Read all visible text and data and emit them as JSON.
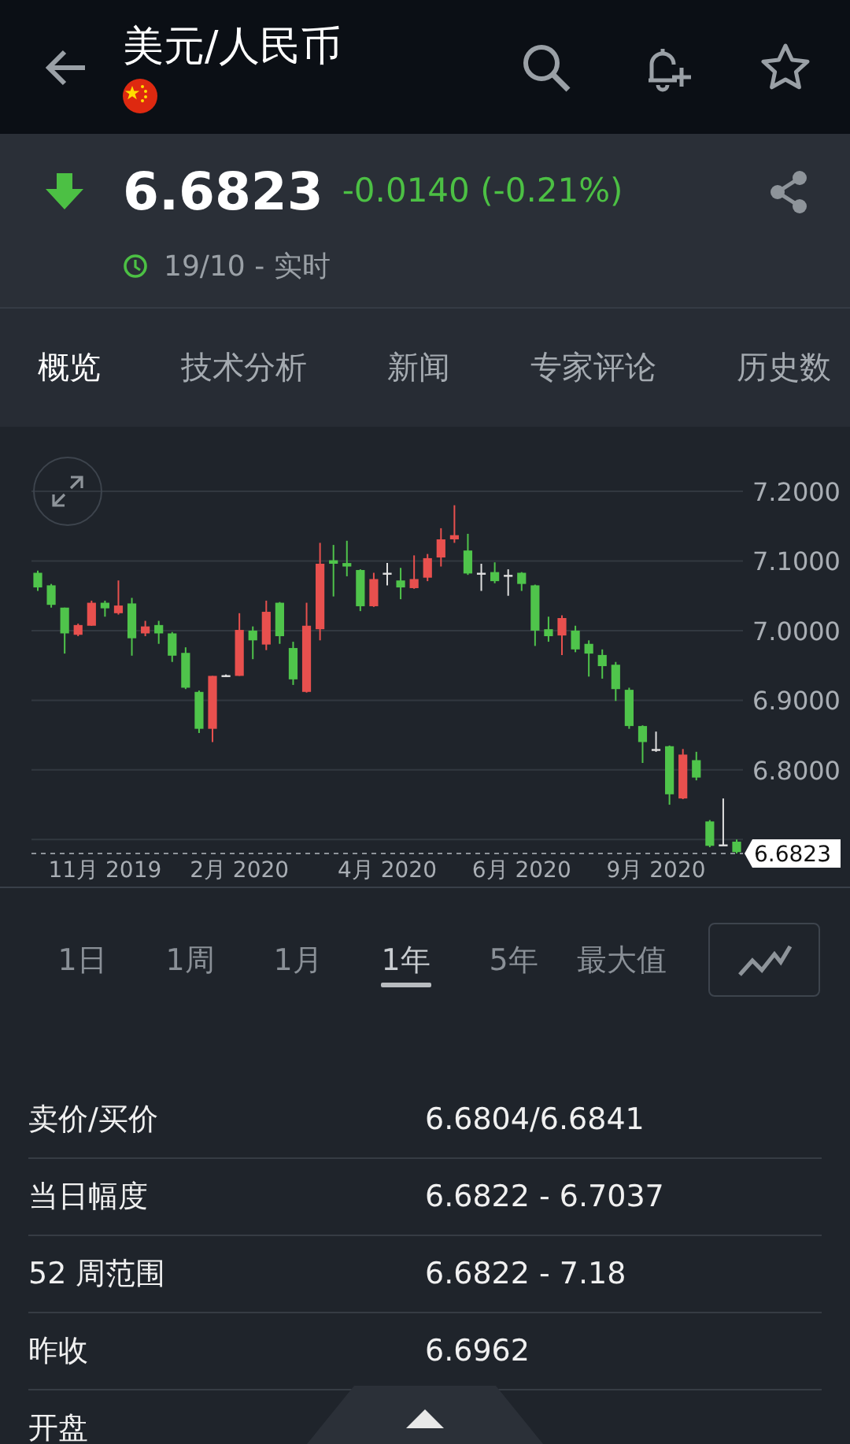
{
  "header": {
    "title": "美元/人民币"
  },
  "quote": {
    "falling": true,
    "price": "6.6823",
    "change": "-0.0140 (-0.21%)",
    "time": "19/10 - 实时"
  },
  "tabs": [
    {
      "label": "概览",
      "selected": true
    },
    {
      "label": "技术分析",
      "selected": false
    },
    {
      "label": "新闻",
      "selected": false
    },
    {
      "label": "专家评论",
      "selected": false
    },
    {
      "label": "历史数",
      "selected": false
    }
  ],
  "chart": {
    "chart_data": {
      "type": "candlestick",
      "grid": true,
      "ylim": [
        6.68,
        7.2
      ],
      "categories": [
        null,
        null,
        null,
        null,
        null,
        "11月 2019",
        null,
        null,
        null,
        null,
        null,
        null,
        null,
        null,
        null,
        "2月 2020",
        null,
        null,
        null,
        null,
        null,
        null,
        null,
        null,
        null,
        null,
        "4月 2020",
        null,
        null,
        null,
        null,
        null,
        null,
        null,
        null,
        null,
        "6月 2020",
        null,
        null,
        null,
        null,
        null,
        null,
        null,
        null,
        null,
        "9月 2020",
        null,
        null,
        null,
        null,
        null,
        null
      ],
      "yticks": [
        {
          "value": 7.2,
          "label": "7.2000"
        },
        {
          "value": 7.1,
          "label": "7.1000"
        },
        {
          "value": 7.0,
          "label": "7.0000"
        },
        {
          "value": 6.9,
          "label": "6.9000"
        },
        {
          "value": 6.8,
          "label": "6.8000"
        }
      ],
      "ref_lines": [
        {
          "label": "6.6823"
        }
      ],
      "ohlc": [
        [
          7.083,
          7.086,
          7.057,
          7.062
        ],
        [
          7.065,
          7.067,
          7.033,
          7.037
        ],
        [
          7.033,
          7.033,
          6.967,
          6.996
        ],
        [
          6.994,
          7.01,
          6.992,
          7.008
        ],
        [
          7.007,
          7.043,
          7.007,
          7.04
        ],
        [
          7.04,
          7.043,
          7.02,
          7.032
        ],
        [
          7.025,
          7.072,
          7.023,
          7.036
        ],
        [
          7.039,
          7.047,
          6.964,
          6.989
        ],
        [
          6.996,
          7.014,
          6.992,
          7.006
        ],
        [
          7.008,
          7.014,
          6.981,
          6.996
        ],
        [
          6.996,
          6.998,
          6.955,
          6.964
        ],
        [
          6.968,
          6.976,
          6.916,
          6.918
        ],
        [
          6.912,
          6.914,
          6.853,
          6.859
        ],
        [
          6.859,
          6.935,
          6.84,
          6.935
        ],
        [
          6.936,
          6.937,
          6.934,
          6.936
        ],
        [
          6.935,
          7.025,
          6.935,
          7.001
        ],
        [
          7.0,
          7.006,
          6.959,
          6.986
        ],
        [
          6.98,
          7.043,
          6.972,
          7.027
        ],
        [
          7.04,
          7.041,
          6.981,
          6.992
        ],
        [
          6.975,
          6.984,
          6.922,
          6.93
        ],
        [
          6.912,
          7.04,
          6.911,
          7.007
        ],
        [
          7.002,
          7.126,
          6.986,
          7.096
        ],
        [
          7.101,
          7.123,
          7.049,
          7.096
        ],
        [
          7.097,
          7.129,
          7.078,
          7.092
        ],
        [
          7.087,
          7.088,
          7.028,
          7.035
        ],
        [
          7.035,
          7.083,
          7.034,
          7.074
        ],
        [
          7.083,
          7.097,
          7.065,
          7.082
        ],
        [
          7.072,
          7.09,
          7.045,
          7.062
        ],
        [
          7.061,
          7.108,
          7.06,
          7.074
        ],
        [
          7.076,
          7.11,
          7.071,
          7.104
        ],
        [
          7.105,
          7.147,
          7.092,
          7.131
        ],
        [
          7.131,
          7.18,
          7.126,
          7.137
        ],
        [
          7.115,
          7.139,
          7.08,
          7.082
        ],
        [
          7.083,
          7.096,
          7.057,
          7.082
        ],
        [
          7.084,
          7.098,
          7.068,
          7.071
        ],
        [
          7.08,
          7.088,
          7.05,
          7.079
        ],
        [
          7.083,
          7.084,
          7.057,
          7.067
        ],
        [
          7.065,
          7.066,
          6.978,
          7.0
        ],
        [
          7.002,
          7.02,
          6.984,
          6.992
        ],
        [
          6.993,
          7.022,
          6.965,
          7.018
        ],
        [
          7.0,
          7.007,
          6.969,
          6.973
        ],
        [
          6.981,
          6.986,
          6.934,
          6.967
        ],
        [
          6.965,
          6.973,
          6.931,
          6.949
        ],
        [
          6.951,
          6.955,
          6.899,
          6.916
        ],
        [
          6.915,
          6.918,
          6.859,
          6.863
        ],
        [
          6.863,
          6.864,
          6.81,
          6.84
        ],
        [
          6.83,
          6.855,
          6.826,
          6.829
        ],
        [
          6.834,
          6.835,
          6.75,
          6.765
        ],
        [
          6.759,
          6.83,
          6.758,
          6.822
        ],
        [
          6.814,
          6.826,
          6.785,
          6.789
        ],
        [
          6.726,
          6.728,
          6.689,
          6.691
        ],
        [
          6.693,
          6.759,
          6.692,
          6.692
        ],
        [
          6.697,
          6.7,
          6.68,
          6.682
        ]
      ]
    }
  },
  "ranges": [
    {
      "label": "1日",
      "selected": false
    },
    {
      "label": "1周",
      "selected": false
    },
    {
      "label": "1月",
      "selected": false
    },
    {
      "label": "1年",
      "selected": true
    },
    {
      "label": "5年",
      "selected": false
    },
    {
      "label": "最大值",
      "selected": false
    }
  ],
  "stats": [
    {
      "label": "卖价/买价",
      "value": "6.6804/6.6841"
    },
    {
      "label": "当日幅度",
      "value": "6.6822 - 6.7037"
    },
    {
      "label": "52 周范围",
      "value": "6.6822 - 7.18"
    },
    {
      "label": "昨收",
      "value": "6.6962"
    },
    {
      "label": "开盘"
    }
  ]
}
